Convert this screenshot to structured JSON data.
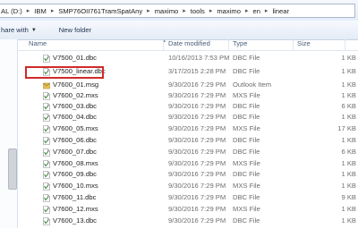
{
  "address": {
    "crumbs": [
      "AL (D:)",
      "IBM",
      "SMP76OII761TramSpatAny",
      "maximo",
      "tools",
      "maximo",
      "en",
      "linear"
    ]
  },
  "toolbar": {
    "share_label": "hare with",
    "new_folder_label": "New folder"
  },
  "columns": {
    "name": "Name",
    "date": "Date modified",
    "type": "Type",
    "size": "Size"
  },
  "files": [
    {
      "name": "V7500_01.dbc",
      "date": "10/16/2013 7:53 PM",
      "type": "DBC File",
      "size": "1 KB",
      "icon": "dbc-file-icon"
    },
    {
      "name": "V7500_linear.dbc",
      "date": "3/17/2015 2:28 PM",
      "type": "DBC File",
      "size": "1 KB",
      "icon": "dbc-file-icon"
    },
    {
      "name": "V7600_01.msg",
      "date": "9/30/2016 7:29 PM",
      "type": "Outlook Item",
      "size": "1 KB",
      "icon": "outlook-item-icon"
    },
    {
      "name": "V7600_02.mxs",
      "date": "9/30/2016 7:29 PM",
      "type": "MXS File",
      "size": "1 KB",
      "icon": "mxs-file-icon"
    },
    {
      "name": "V7600_03.dbc",
      "date": "9/30/2016 7:29 PM",
      "type": "DBC File",
      "size": "6 KB",
      "icon": "dbc-file-icon"
    },
    {
      "name": "V7600_04.dbc",
      "date": "9/30/2016 7:29 PM",
      "type": "DBC File",
      "size": "1 KB",
      "icon": "dbc-file-icon"
    },
    {
      "name": "V7600_05.mxs",
      "date": "9/30/2016 7:29 PM",
      "type": "MXS File",
      "size": "17 KB",
      "icon": "mxs-file-icon"
    },
    {
      "name": "V7600_06.dbc",
      "date": "9/30/2016 7:29 PM",
      "type": "DBC File",
      "size": "1 KB",
      "icon": "dbc-file-icon"
    },
    {
      "name": "V7600_07.dbc",
      "date": "9/30/2016 7:29 PM",
      "type": "DBC File",
      "size": "6 KB",
      "icon": "dbc-file-icon"
    },
    {
      "name": "V7600_08.mxs",
      "date": "9/30/2016 7:29 PM",
      "type": "MXS File",
      "size": "1 KB",
      "icon": "mxs-file-icon"
    },
    {
      "name": "V7600_09.dbc",
      "date": "9/30/2016 7:29 PM",
      "type": "DBC File",
      "size": "1 KB",
      "icon": "dbc-file-icon"
    },
    {
      "name": "V7600_10.mxs",
      "date": "9/30/2016 7:29 PM",
      "type": "MXS File",
      "size": "1 KB",
      "icon": "mxs-file-icon"
    },
    {
      "name": "V7600_11.dbc",
      "date": "9/30/2016 7:29 PM",
      "type": "DBC File",
      "size": "9 KB",
      "icon": "dbc-file-icon"
    },
    {
      "name": "V7600_12.mxs",
      "date": "9/30/2016 7:29 PM",
      "type": "MXS File",
      "size": "1 KB",
      "icon": "mxs-file-icon"
    },
    {
      "name": "V7600_13.dbc",
      "date": "9/30/2016 7:29 PM",
      "type": "DBC File",
      "size": "1 KB",
      "icon": "dbc-file-icon"
    }
  ],
  "selected_file": "V7500_linear.dbc",
  "colors": {
    "highlight": "#d22a2a",
    "folder": "#e8c25a"
  }
}
